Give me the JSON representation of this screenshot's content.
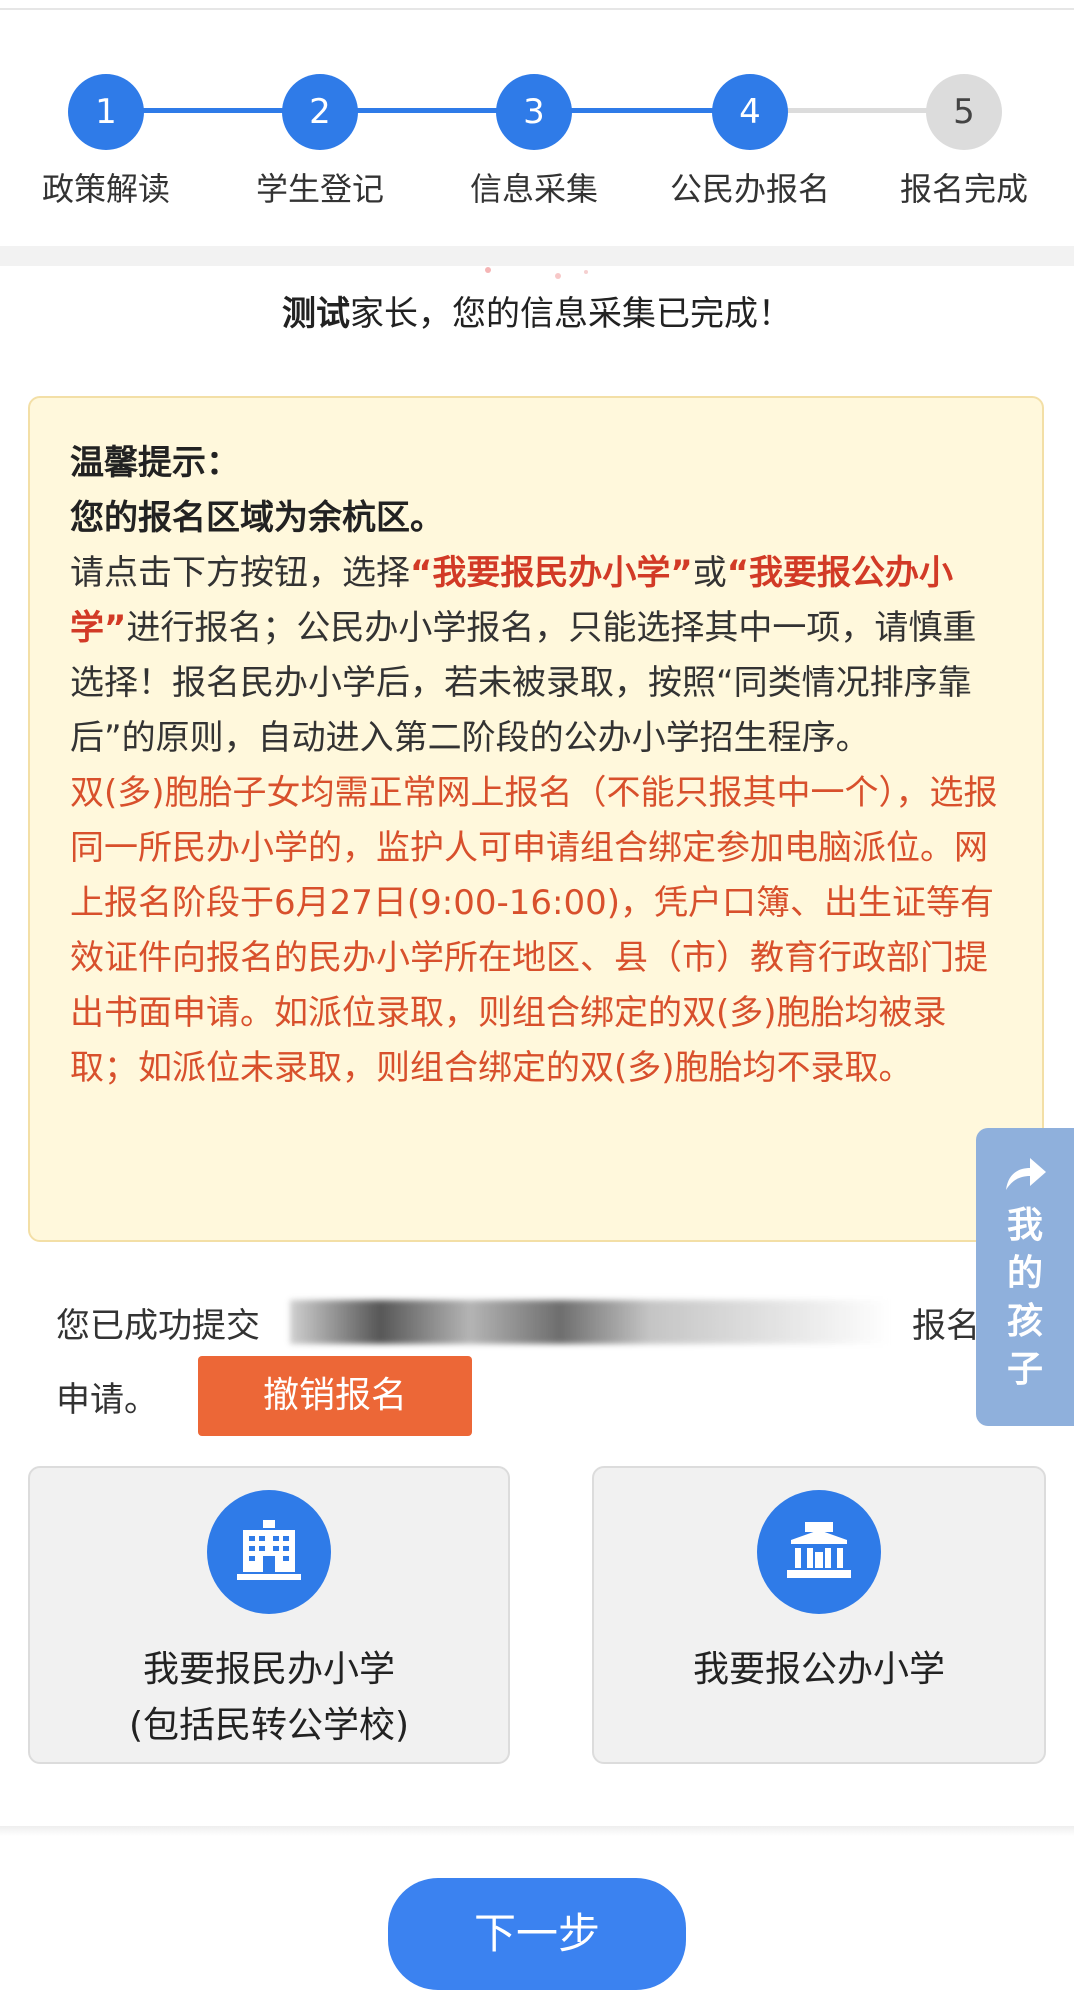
{
  "stepper": {
    "steps": [
      {
        "number": "1",
        "label": "政策解读"
      },
      {
        "number": "2",
        "label": "学生登记"
      },
      {
        "number": "3",
        "label": "信息采集"
      },
      {
        "number": "4",
        "label": "公民办报名"
      },
      {
        "number": "5",
        "label": "报名完成"
      }
    ],
    "active_color": "#2f7be8",
    "inactive_color": "#dcdcdc"
  },
  "greeting": {
    "name": "测试",
    "rest": "家长，您的信息采集已完成！"
  },
  "tips": {
    "title": "温馨提示：",
    "area": "您的报名区域为余杭区。",
    "p1_a": "请点击下方按钮，选择",
    "p1_b": "“我要报民办小学”",
    "p1_c": "或",
    "p1_d": "“我要报公办小学”",
    "p1_e": "进行报名；公民办小学报名，只能选择其中一项，请慎重选择！报名民办小学后，若未被录取，按照“同类情况排序靠后”的原则，自动进入第二阶段的公办小学招生程序。",
    "p2": "双(多)胞胎子女均需正常网上报名（不能只报其中一个），选报同一所民办小学的，监护人可申请组合绑定参加电脑派位。网上报名阶段于6月27日(9:00-16:00)，凭户口簿、出生证等有效证件向报名的民办小学所在地区、县（市）教育行政部门提出书面申请。如派位录取，则组合绑定的双(多)胞胎均被录取；如派位未录取，则组合绑定的双(多)胞胎均不录取。"
  },
  "side_float": {
    "label": "我的孩子",
    "icon": "share-arrow-icon"
  },
  "submission": {
    "prefix": "您已成功提交",
    "suffix": "报名",
    "end": "申请。",
    "cancel_label": "撤销报名"
  },
  "options": [
    {
      "icon": "private-school-building-icon",
      "line1": "我要报民办小学",
      "line2": "(包括民转公学校)"
    },
    {
      "icon": "public-school-building-icon",
      "line1": "我要报公办小学",
      "line2": ""
    }
  ],
  "footer": {
    "next_label": "下一步",
    "accent": "#3b82f0"
  }
}
